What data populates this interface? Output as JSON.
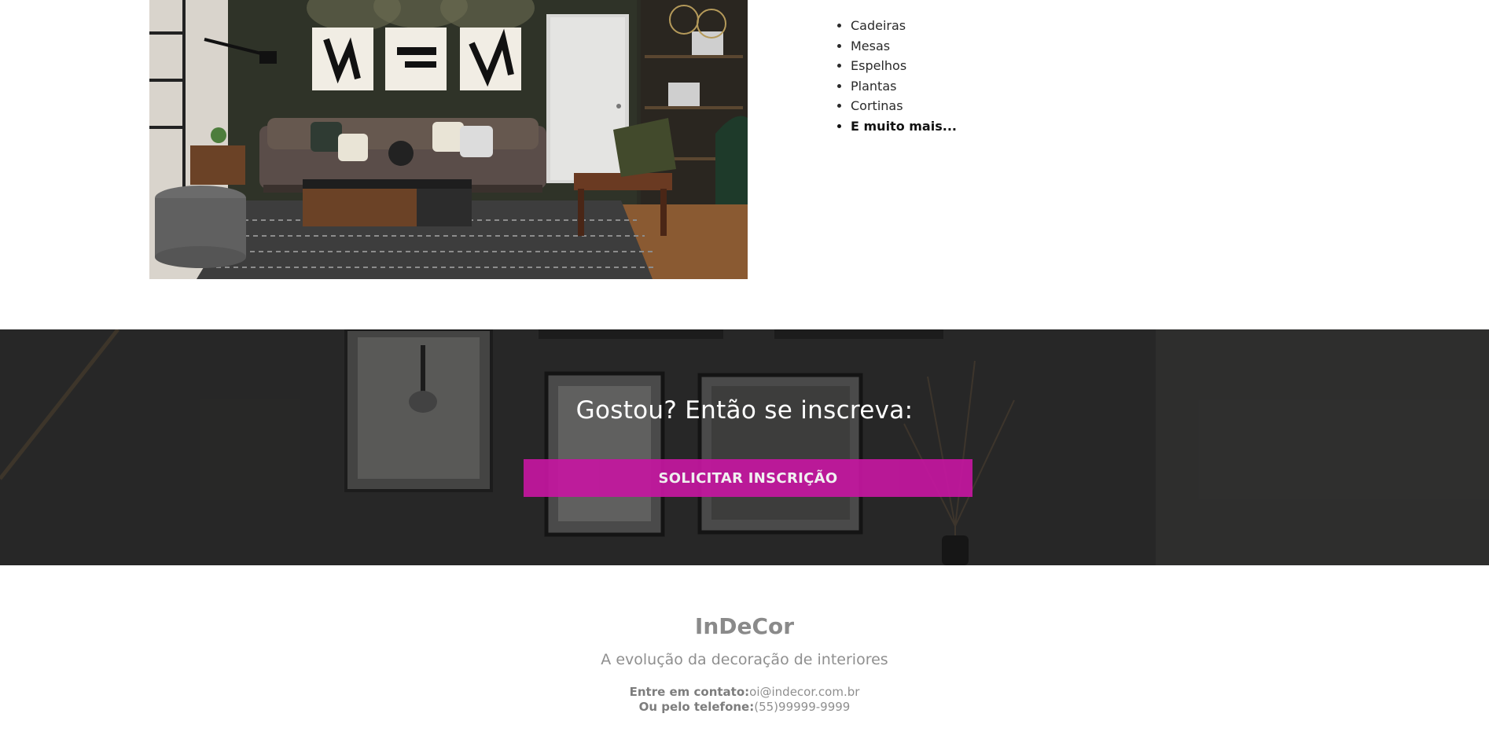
{
  "products": {
    "items": [
      "Cadeiras",
      "Mesas",
      "Espelhos",
      "Plantas",
      "Cortinas"
    ],
    "more_label": "E muito mais..."
  },
  "subscribe": {
    "title": "Gostou? Então se inscreva:",
    "button_label": "SOLICITAR INSCRIÇÃO",
    "button_color": "#c4179f"
  },
  "footer": {
    "brand": "InDeCor",
    "tagline": "A evolução da decoração de interiores",
    "contact_label": "Entre em contato:",
    "contact_email": "oi@indecor.com.br",
    "phone_label": "Ou pelo telefone:",
    "phone": "(55)99999-9999"
  }
}
